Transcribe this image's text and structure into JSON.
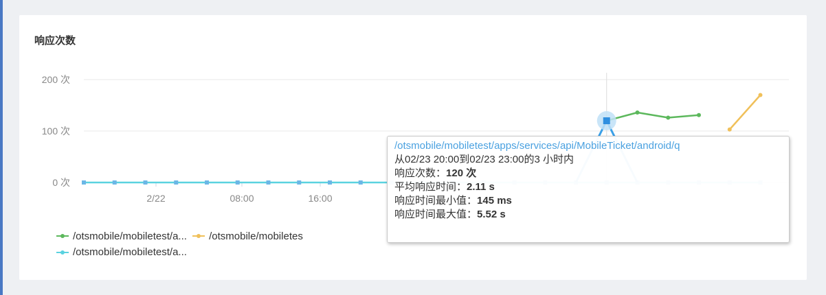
{
  "panel": {
    "title": "响应次数"
  },
  "chart_data": {
    "type": "line",
    "y_ticks": [
      "200 次",
      "100 次",
      "0 次"
    ],
    "ylim": [
      0,
      200
    ],
    "x_ticks": [
      "2/22",
      "08:00",
      "16:00"
    ],
    "series": [
      {
        "name": "/otsmobile/mobiletest/a...",
        "color": "#5cb85c",
        "values": [
          null,
          null,
          null,
          null,
          null,
          null,
          null,
          null,
          null,
          null,
          null,
          null,
          null,
          null,
          null,
          null,
          null,
          120,
          136,
          126,
          131,
          null,
          null
        ]
      },
      {
        "name": "/otsmobile/mobiletes",
        "color": "#f0c05a",
        "values": [
          null,
          null,
          null,
          null,
          null,
          null,
          null,
          null,
          null,
          null,
          null,
          null,
          null,
          null,
          null,
          null,
          null,
          null,
          null,
          null,
          null,
          103,
          170
        ]
      },
      {
        "name": "/otsmobile/mobiletest/a...",
        "color": "#5ad2e0",
        "values": [
          0,
          0,
          0,
          0,
          0,
          0,
          0,
          0,
          0,
          0,
          0,
          0,
          0,
          0,
          0,
          0,
          0,
          0,
          0,
          0,
          0,
          0,
          0
        ]
      }
    ],
    "highlight_index": 17
  },
  "tooltip": {
    "path": "/otsmobile/mobiletest/apps/services/api/MobileTicket/android/q",
    "range": "从02/23 20:00到02/23 23:00的3 小时内",
    "count_label": "响应次数：",
    "count_value": "120 次",
    "avg_label": "平均响应时间：",
    "avg_value": "2.11 s",
    "min_label": "响应时间最小值：",
    "min_value": "145 ms",
    "max_label": "响应时间最大值：",
    "max_value": "5.52 s"
  }
}
